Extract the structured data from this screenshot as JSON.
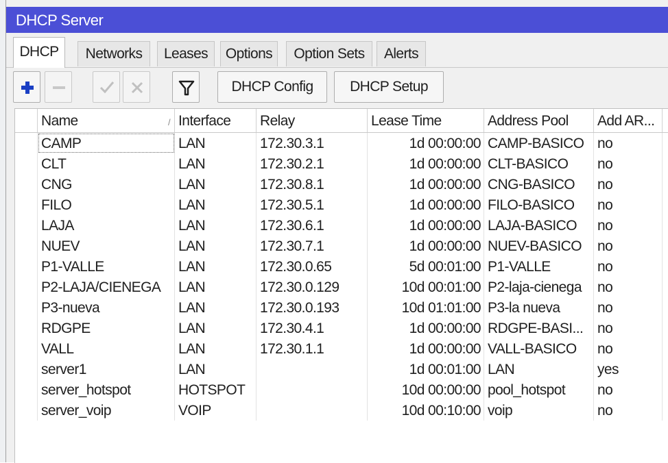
{
  "window": {
    "title": "DHCP Server"
  },
  "tabs": [
    {
      "label": "DHCP",
      "active": true
    },
    {
      "label": "Networks"
    },
    {
      "label": "Leases"
    },
    {
      "label": "Options"
    },
    {
      "label": "Option Sets"
    },
    {
      "label": "Alerts"
    }
  ],
  "toolbar": {
    "add_icon": "plus-icon",
    "remove_icon": "minus-icon",
    "enable_icon": "check-icon",
    "disable_icon": "x-icon",
    "filter_icon": "filter-icon",
    "dhcp_config_label": "DHCP Config",
    "dhcp_setup_label": "DHCP Setup",
    "accent_color": "#1a3fc4"
  },
  "table": {
    "columns": [
      "Name",
      "Interface",
      "Relay",
      "Lease Time",
      "Address Pool",
      "Add AR..."
    ],
    "sort_indicator": "/",
    "rows": [
      [
        "CAMP",
        "LAN",
        "172.30.3.1",
        "1d 00:00:00",
        "CAMP-BASICO",
        "no"
      ],
      [
        "CLT",
        "LAN",
        "172.30.2.1",
        "1d 00:00:00",
        "CLT-BASICO",
        "no"
      ],
      [
        "CNG",
        "LAN",
        "172.30.8.1",
        "1d 00:00:00",
        "CNG-BASICO",
        "no"
      ],
      [
        "FILO",
        "LAN",
        "172.30.5.1",
        "1d 00:00:00",
        "FILO-BASICO",
        "no"
      ],
      [
        "LAJA",
        "LAN",
        "172.30.6.1",
        "1d 00:00:00",
        "LAJA-BASICO",
        "no"
      ],
      [
        "NUEV",
        "LAN",
        "172.30.7.1",
        "1d 00:00:00",
        "NUEV-BASICO",
        "no"
      ],
      [
        "P1-VALLE",
        "LAN",
        "172.30.0.65",
        "5d 00:01:00",
        "P1-VALLE",
        "no"
      ],
      [
        "P2-LAJA/CIENEGA",
        "LAN",
        "172.30.0.129",
        "10d 00:01:00",
        "P2-laja-cienega",
        "no"
      ],
      [
        "P3-nueva",
        "LAN",
        "172.30.0.193",
        "10d 01:01:00",
        "P3-la nueva",
        "no"
      ],
      [
        "RDGPE",
        "LAN",
        "172.30.4.1",
        "1d 00:00:00",
        "RDGPE-BASI...",
        "no"
      ],
      [
        "VALL",
        "LAN",
        "172.30.1.1",
        "1d 00:00:00",
        "VALL-BASICO",
        "no"
      ],
      [
        "server1",
        "LAN",
        "",
        "1d 00:01:00",
        "LAN",
        "yes"
      ],
      [
        "server_hotspot",
        "HOTSPOT",
        "",
        "10d 00:00:00",
        "pool_hotspot",
        "no"
      ],
      [
        "server_voip",
        "VOIP",
        "",
        "10d 00:10:00",
        "voip",
        "no"
      ]
    ]
  }
}
